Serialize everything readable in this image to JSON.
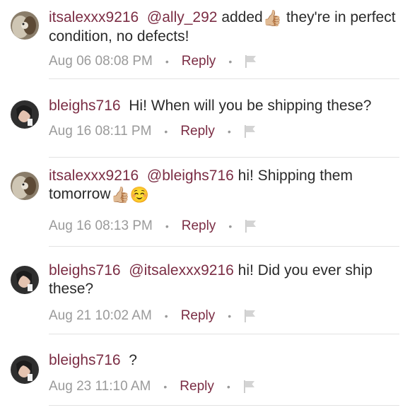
{
  "comments": [
    {
      "username": "itsalexxx9216",
      "mention": "@ally_292",
      "text": "added",
      "text2": "they're in perfect condition, no defects!",
      "emoji": "👍🏼",
      "time": "Aug 06 08:08 PM",
      "reply_label": "Reply"
    },
    {
      "username": "bleighs716",
      "text": "Hi! When will you be shipping these?",
      "time": "Aug 16 08:11 PM",
      "reply_label": "Reply"
    },
    {
      "username": "itsalexxx9216",
      "mention": "@bleighs716",
      "text": "hi! Shipping them tomorrow",
      "emoji": "👍🏼☺️",
      "time": "Aug 16 08:13 PM",
      "reply_label": "Reply"
    },
    {
      "username": "bleighs716",
      "mention": "@itsalexxx9216",
      "text": "hi! Did you ever ship these?",
      "time": "Aug 21 10:02 AM",
      "reply_label": "Reply"
    },
    {
      "username": "bleighs716",
      "text": "?",
      "time": "Aug 23 11:10 AM",
      "reply_label": "Reply"
    }
  ],
  "colors": {
    "username": "#7b2d44",
    "reply": "#7b2d44",
    "meta": "#9a9a9a",
    "divider": "#e2e2e2"
  },
  "icons": {
    "flag": "flag-icon",
    "separator": "bullet-dot"
  }
}
